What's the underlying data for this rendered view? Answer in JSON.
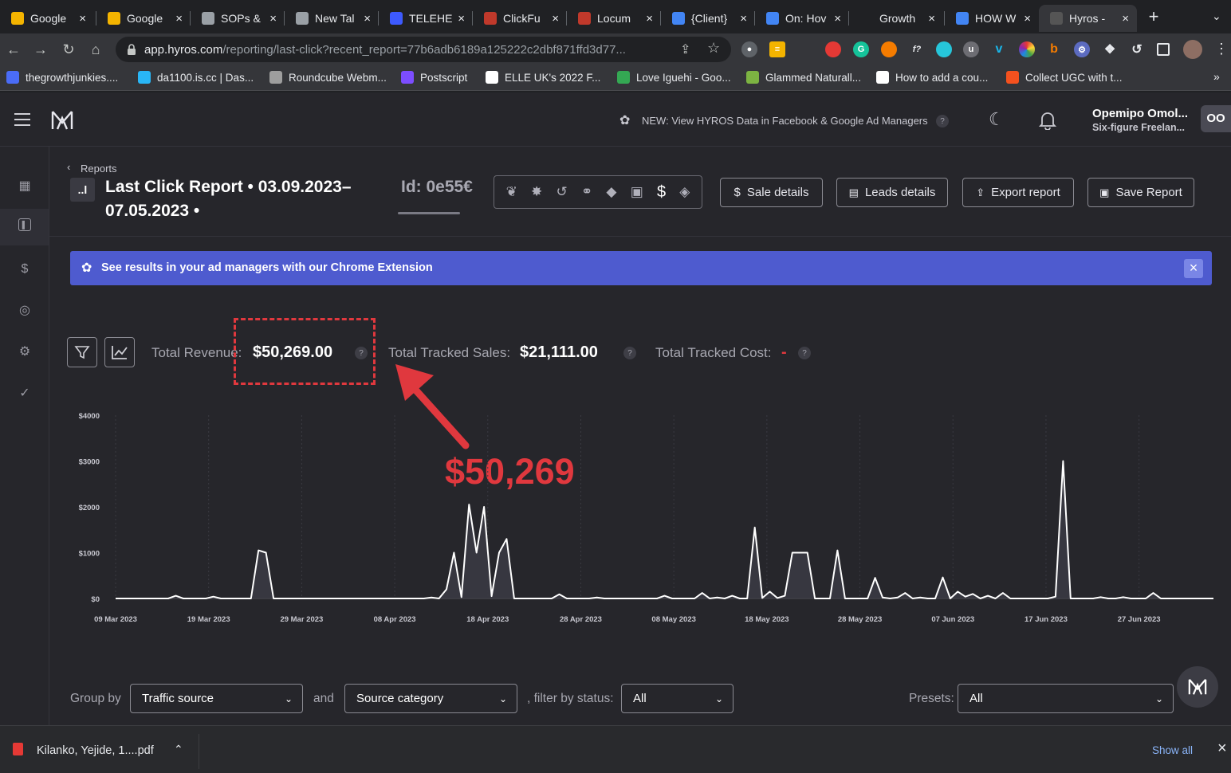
{
  "tabs": [
    {
      "title": "Google",
      "icon": "google-slides-icon",
      "color": "#f4b400"
    },
    {
      "title": "Google",
      "icon": "google-slides-icon",
      "color": "#f4b400"
    },
    {
      "title": "SOPs &",
      "icon": "paperclip-icon",
      "color": "#9aa0a6"
    },
    {
      "title": "New Tal",
      "icon": "chrome-icon",
      "color": "#9aa0a6"
    },
    {
      "title": "TELEHE",
      "icon": "telehe-icon",
      "color": "#3d5afe"
    },
    {
      "title": "ClickFu",
      "icon": "clickfunnels-icon",
      "color": "#c0392b"
    },
    {
      "title": "Locum",
      "icon": "clickfunnels-icon",
      "color": "#c0392b"
    },
    {
      "title": "{Client}",
      "icon": "google-docs-icon",
      "color": "#4285f4"
    },
    {
      "title": "On: Hov",
      "icon": "google-docs-icon",
      "color": "#4285f4"
    },
    {
      "title": "Growth",
      "icon": "",
      "color": ""
    },
    {
      "title": "HOW W",
      "icon": "google-docs-icon",
      "color": "#4285f4"
    },
    {
      "title": "Hyros -",
      "icon": "hyros-icon",
      "color": "#555"
    }
  ],
  "address": {
    "host": "app.hyros.com",
    "path": "/reporting/last-click?recent_report=77b6adb6189a125222c2dbf871ffd3d77..."
  },
  "bookmarks": [
    {
      "label": "thegrowthjunkies....",
      "color": "#4a6cf7"
    },
    {
      "label": "da1100.is.cc | Das...",
      "color": "#29b6f6"
    },
    {
      "label": "Roundcube Webm...",
      "color": "#9e9e9e"
    },
    {
      "label": "Postscript",
      "color": "#7c4dff"
    },
    {
      "label": "ELLE UK's 2022 F...",
      "color": "#ffffff"
    },
    {
      "label": "Love Iguehi - Goo...",
      "color": "#34a853"
    },
    {
      "label": "Glammed Naturall...",
      "color": "#7cb342"
    },
    {
      "label": "How to add a cou...",
      "color": "#ffffff"
    },
    {
      "label": "Collect UGC with t...",
      "color": "#f4511e"
    }
  ],
  "topbar": {
    "announcement": "NEW: View HYROS Data in Facebook & Google Ad Managers",
    "user_name": "Opemipo Omol...",
    "user_subtitle": "Six-figure Freelan...",
    "avatar_initials": "OO"
  },
  "report": {
    "breadcrumb": "Reports",
    "title_line1": "Last Click Report • 03.09.2023–",
    "title_line2": "07.05.2023 •",
    "id_label": "Id: 0e55€"
  },
  "actions": {
    "sale_details": "Sale details",
    "leads_details": "Leads details",
    "export_report": "Export report",
    "save_report": "Save Report"
  },
  "banner": {
    "text": "See results in your ad managers with our Chrome Extension",
    "color": "#4e5bcf"
  },
  "stats": {
    "total_revenue_label": "Total Revenue:",
    "total_revenue_value": "$50,269.00",
    "tracked_sales_label": "Total Tracked Sales:",
    "tracked_sales_value": "$21,111.00",
    "tracked_cost_label": "Total Tracked Cost:",
    "tracked_cost_value": "-"
  },
  "annotation": {
    "text": "$50,269",
    "color": "#e0383e"
  },
  "chart_data": {
    "type": "area",
    "y_ticks": [
      "$4000",
      "$3000",
      "$2000",
      "$1000",
      "$0"
    ],
    "ylim": [
      0,
      4000
    ],
    "x_tick_labels": [
      "09 Mar 2023",
      "19 Mar 2023",
      "29 Mar 2023",
      "08 Apr 2023",
      "18 Apr 2023",
      "28 Apr 2023",
      "08 May 2023",
      "18 May 2023",
      "28 May 2023",
      "07 Jun 2023",
      "17 Jun 2023",
      "27 Jun 2023"
    ],
    "x_start": "2023-03-09",
    "x_end": "2023-07-05",
    "series": [
      {
        "values": [
          0,
          0,
          0,
          0,
          0,
          0,
          0,
          0,
          60,
          0,
          0,
          0,
          0,
          40,
          0,
          0,
          0,
          0,
          0,
          1050,
          1000,
          0,
          0,
          0,
          0,
          0,
          0,
          0,
          0,
          0,
          0,
          0,
          0,
          0,
          0,
          0,
          0,
          0,
          0,
          0,
          0,
          0,
          20,
          0,
          200,
          1000,
          30,
          2050,
          1000,
          2000,
          50,
          1000,
          1300,
          0,
          0,
          0,
          0,
          0,
          0,
          90,
          0,
          0,
          0,
          0,
          20,
          0,
          0,
          0,
          0,
          0,
          0,
          0,
          0,
          60,
          0,
          0,
          0,
          0,
          120,
          0,
          20,
          0,
          60,
          0,
          0,
          1550,
          10,
          150,
          10,
          60,
          1000,
          1000,
          1000,
          0,
          0,
          0,
          1050,
          0,
          0,
          0,
          0,
          450,
          20,
          0,
          20,
          120,
          0,
          20,
          0,
          0,
          460,
          0,
          150,
          40,
          100,
          0,
          60,
          0,
          120,
          0,
          0,
          0,
          0,
          0,
          0,
          40,
          3000,
          0,
          0,
          0,
          0,
          30,
          0,
          0,
          30,
          0,
          0,
          0,
          120,
          0,
          0,
          0,
          0,
          0,
          0,
          0,
          0
        ]
      }
    ],
    "grid": true
  },
  "filters": {
    "group_by_label": "Group by",
    "group_by_value": "Traffic source",
    "and_label": "and",
    "source_category_value": "Source category",
    "filter_status_label": ", filter by status:",
    "status_value": "All",
    "presets_label": "Presets:",
    "presets_value": "All"
  },
  "download": {
    "file": "Kilanko, Yejide, 1....pdf",
    "show_all": "Show all"
  }
}
